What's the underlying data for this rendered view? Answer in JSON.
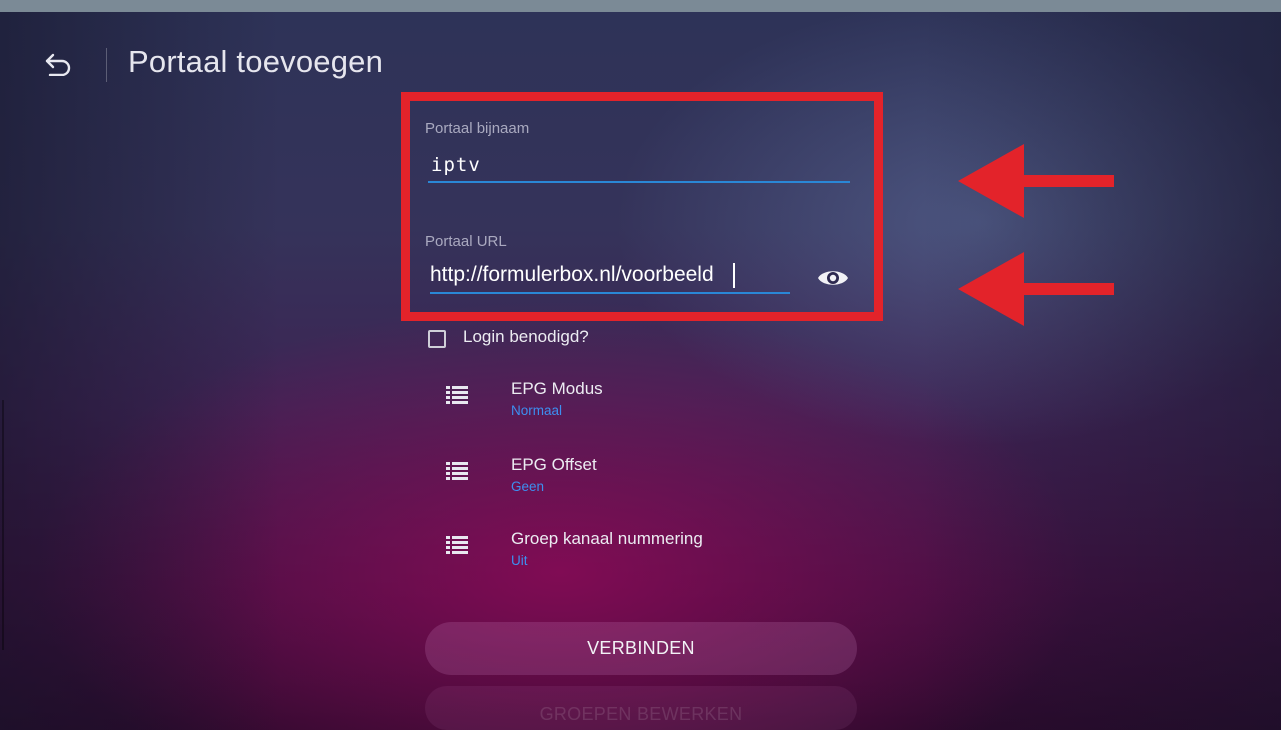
{
  "header": {
    "title": "Portaal toevoegen"
  },
  "form": {
    "nickname": {
      "label": "Portaal bijnaam",
      "value": "iptv"
    },
    "url": {
      "label": "Portaal URL",
      "value": "http://formulerbox.nl/voorbeeld"
    },
    "login": {
      "label": "Login benodigd?",
      "checked": false
    }
  },
  "settings": [
    {
      "title": "EPG Modus",
      "value": "Normaal"
    },
    {
      "title": "EPG Offset",
      "value": "Geen"
    },
    {
      "title": "Groep kanaal nummering",
      "value": "Uit"
    }
  ],
  "buttons": {
    "connect": "VERBINDEN",
    "edit_groups": "GROEPEN BEWERKEN"
  },
  "icons": {
    "back": "back-arrow-icon",
    "password_toggle": "eye-icon",
    "setting": "list-icon"
  },
  "colors": {
    "accent": "#2a87d6",
    "setting_value": "#3d8ff0",
    "annotation": "#e3232a"
  }
}
